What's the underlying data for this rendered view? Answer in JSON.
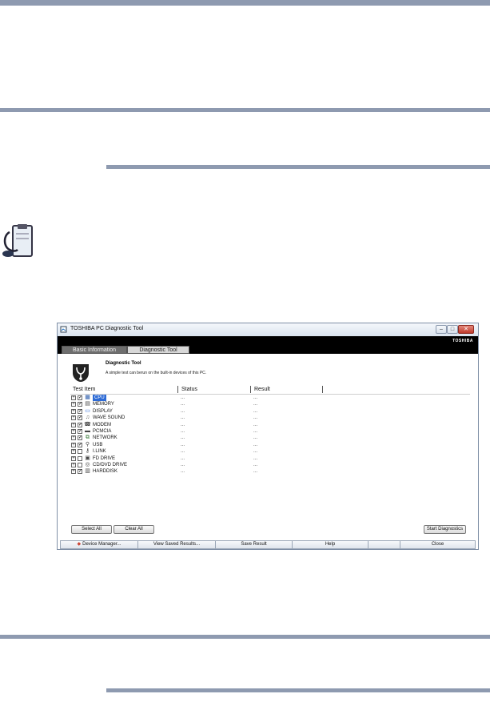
{
  "window": {
    "title": "TOSHIBA PC Diagnostic Tool",
    "brand": "TOSHIBA",
    "controls": {
      "minimize": "–",
      "maximize": "□",
      "close": "✕"
    }
  },
  "tabs": [
    {
      "label": "Basic Information"
    },
    {
      "label": "Diagnostic Tool"
    }
  ],
  "panel": {
    "heading": "Diagnostic Tool",
    "description": "A simple test can berun on the built-in devices of this PC."
  },
  "columns": {
    "test_item": "Test Item",
    "status": "Status",
    "result": "Result"
  },
  "items": [
    {
      "name": "CPU",
      "checked": true,
      "icon": "cpu-icon",
      "status": "...",
      "result": "...",
      "selected": true
    },
    {
      "name": "MEMORY",
      "checked": true,
      "icon": "memory-icon",
      "status": "...",
      "result": "..."
    },
    {
      "name": "DISPLAY",
      "checked": true,
      "icon": "display-icon",
      "status": "...",
      "result": "..."
    },
    {
      "name": "WAVE SOUND",
      "checked": true,
      "icon": "sound-icon",
      "status": "...",
      "result": "..."
    },
    {
      "name": "MODEM",
      "checked": true,
      "icon": "modem-icon",
      "status": "...",
      "result": "..."
    },
    {
      "name": "PCMCIA",
      "checked": true,
      "icon": "pcmcia-icon",
      "status": "...",
      "result": "..."
    },
    {
      "name": "NETWORK",
      "checked": true,
      "icon": "network-icon",
      "status": "...",
      "result": "..."
    },
    {
      "name": "USB",
      "checked": true,
      "icon": "usb-icon",
      "status": "...",
      "result": "..."
    },
    {
      "name": "I.LINK",
      "checked": false,
      "icon": "ilink-icon",
      "status": "...",
      "result": "..."
    },
    {
      "name": "FD DRIVE",
      "checked": false,
      "icon": "fd-drive-icon",
      "status": "...",
      "result": "..."
    },
    {
      "name": "CD/DVD DRIVE",
      "checked": false,
      "icon": "cd-dvd-icon",
      "status": "...",
      "result": "..."
    },
    {
      "name": "HARDDISK",
      "checked": true,
      "icon": "harddisk-icon",
      "status": "...",
      "result": "..."
    }
  ],
  "buttons": {
    "select_all": "Select All",
    "clear_all": "Clear All",
    "start": "Start Diagnostics"
  },
  "bottom": {
    "device_manager": "Device Manager...",
    "view_saved": "View Saved Results...",
    "save_result": "Save Result",
    "help": "Help",
    "close": "Close"
  },
  "colors": {
    "rule": "#8e9ab0",
    "selection": "#2e6bd6",
    "header_bar": "#000000"
  }
}
